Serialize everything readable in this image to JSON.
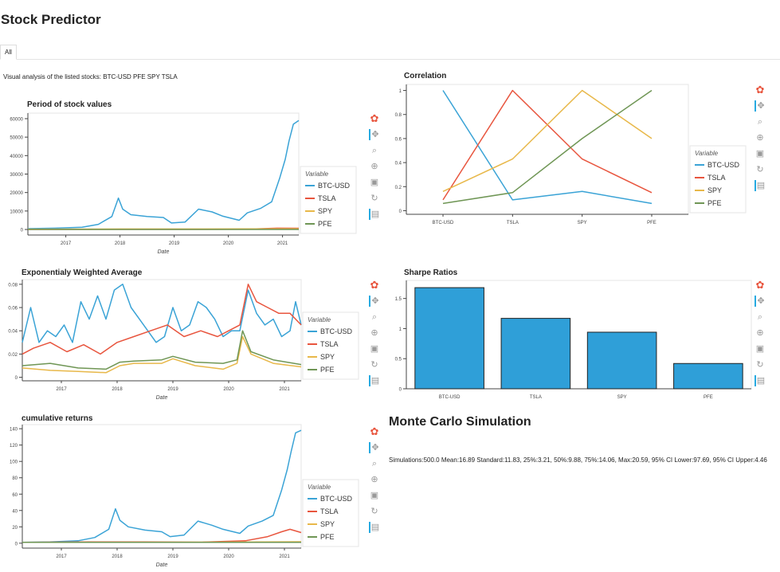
{
  "app": {
    "title": "Stock Predictor"
  },
  "tabs": [
    {
      "label": "All"
    }
  ],
  "intro": {
    "text": "Visual analysis of the listed stocks: BTC-USD PFE SPY TSLA"
  },
  "colors": {
    "BTC-USD": "#3aa3d6",
    "TSLA": "#e8553e",
    "SPY": "#e8b84a",
    "PFE": "#6f9655",
    "bar": "#2f9fd8"
  },
  "legend": {
    "title": "Variable",
    "items": [
      "BTC-USD",
      "TSLA",
      "SPY",
      "PFE"
    ]
  },
  "toolbar": {
    "icons": [
      "bokeh-logo-icon",
      "pan-icon",
      "box-zoom-icon",
      "wheel-zoom-icon",
      "save-icon",
      "reset-icon",
      "hover-icon"
    ]
  },
  "monte_carlo": {
    "title": "Monte Carlo Simulation",
    "text": "Simulations:500.0 Mean:16.89 Standard:11.83, 25%:3.21, 50%:9.88, 75%:14.06, Max:20.59, 95% CI Lower:97.69, 95% CI Upper:4.46"
  },
  "chart_data": [
    {
      "id": "stock-values",
      "type": "line",
      "title": "Period of stock values",
      "xlabel": "Date",
      "ylabel": "",
      "xticks": [
        "2017",
        "2018",
        "2019",
        "2020",
        "2021"
      ],
      "xlim": [
        2016.3,
        2021.3
      ],
      "ylim": [
        -3000,
        63000
      ],
      "yticks": [
        0,
        10000,
        20000,
        30000,
        40000,
        50000,
        60000
      ],
      "legend_position": "right",
      "series": [
        {
          "name": "BTC-USD",
          "x": [
            2016.3,
            2016.8,
            2017.3,
            2017.6,
            2017.85,
            2017.97,
            2018.05,
            2018.2,
            2018.5,
            2018.8,
            2018.95,
            2019.2,
            2019.45,
            2019.7,
            2019.9,
            2020.2,
            2020.35,
            2020.6,
            2020.8,
            2020.95,
            2021.05,
            2021.12,
            2021.2,
            2021.3
          ],
          "y": [
            450,
            700,
            1200,
            2800,
            7000,
            17000,
            11000,
            8000,
            7000,
            6500,
            3500,
            4000,
            11000,
            9500,
            7200,
            5000,
            9000,
            11500,
            15000,
            28000,
            38000,
            48000,
            57000,
            59000
          ]
        },
        {
          "name": "TSLA",
          "x": [
            2016.3,
            2017.5,
            2018.5,
            2019.5,
            2020.3,
            2020.9,
            2021.3
          ],
          "y": [
            40,
            60,
            70,
            50,
            150,
            700,
            650
          ]
        },
        {
          "name": "SPY",
          "x": [
            2016.3,
            2018,
            2019.5,
            2020.3,
            2021.3
          ],
          "y": [
            210,
            260,
            290,
            300,
            390
          ]
        },
        {
          "name": "PFE",
          "x": [
            2016.3,
            2021.3
          ],
          "y": [
            33,
            37
          ]
        }
      ]
    },
    {
      "id": "correlation",
      "type": "line",
      "title": "Correlation",
      "xlabel": "",
      "ylabel": "",
      "categories": [
        "BTC-USD",
        "TSLA",
        "SPY",
        "PFE"
      ],
      "ylim": [
        -0.03,
        1.05
      ],
      "yticks": [
        0,
        0.2,
        0.4,
        0.6,
        0.8,
        1
      ],
      "legend_position": "right",
      "series": [
        {
          "name": "BTC-USD",
          "values": [
            1.0,
            0.09,
            0.16,
            0.06
          ]
        },
        {
          "name": "TSLA",
          "values": [
            0.09,
            1.0,
            0.43,
            0.15
          ]
        },
        {
          "name": "SPY",
          "values": [
            0.16,
            0.43,
            1.0,
            0.6
          ]
        },
        {
          "name": "PFE",
          "values": [
            0.06,
            0.15,
            0.6,
            1.0
          ]
        }
      ]
    },
    {
      "id": "ewa",
      "type": "line",
      "title": "Exponentialy Weighted Average",
      "xlabel": "Date",
      "ylabel": "",
      "xticks": [
        "2017",
        "2018",
        "2019",
        "2020",
        "2021"
      ],
      "xlim": [
        2016.3,
        2021.3
      ],
      "ylim": [
        -0.003,
        0.084
      ],
      "yticks": [
        0,
        0.02,
        0.04,
        0.06,
        0.08
      ],
      "legend_position": "right",
      "series": [
        {
          "name": "BTC-USD",
          "x": [
            2016.3,
            2016.45,
            2016.6,
            2016.75,
            2016.9,
            2017.05,
            2017.2,
            2017.35,
            2017.5,
            2017.65,
            2017.8,
            2017.95,
            2018.1,
            2018.25,
            2018.4,
            2018.55,
            2018.7,
            2018.85,
            2019.0,
            2019.15,
            2019.3,
            2019.45,
            2019.6,
            2019.75,
            2019.9,
            2020.05,
            2020.2,
            2020.35,
            2020.5,
            2020.65,
            2020.8,
            2020.95,
            2021.1,
            2021.2,
            2021.3
          ],
          "y": [
            0.03,
            0.06,
            0.03,
            0.04,
            0.035,
            0.045,
            0.03,
            0.065,
            0.05,
            0.07,
            0.05,
            0.075,
            0.08,
            0.06,
            0.05,
            0.04,
            0.03,
            0.035,
            0.06,
            0.04,
            0.045,
            0.065,
            0.06,
            0.05,
            0.035,
            0.04,
            0.04,
            0.075,
            0.055,
            0.045,
            0.05,
            0.035,
            0.04,
            0.065,
            0.045
          ]
        },
        {
          "name": "TSLA",
          "x": [
            2016.3,
            2016.5,
            2016.8,
            2017.1,
            2017.4,
            2017.7,
            2018.0,
            2018.3,
            2018.6,
            2018.9,
            2019.2,
            2019.5,
            2019.8,
            2020.0,
            2020.2,
            2020.35,
            2020.5,
            2020.7,
            2020.9,
            2021.1,
            2021.3
          ],
          "y": [
            0.02,
            0.025,
            0.03,
            0.022,
            0.028,
            0.02,
            0.03,
            0.035,
            0.04,
            0.045,
            0.035,
            0.04,
            0.035,
            0.04,
            0.045,
            0.08,
            0.065,
            0.06,
            0.055,
            0.055,
            0.045
          ]
        },
        {
          "name": "SPY",
          "x": [
            2016.3,
            2016.8,
            2017.3,
            2017.8,
            2018.05,
            2018.3,
            2018.8,
            2019.0,
            2019.4,
            2019.9,
            2020.15,
            2020.25,
            2020.4,
            2020.8,
            2021.3
          ],
          "y": [
            0.008,
            0.006,
            0.005,
            0.004,
            0.01,
            0.012,
            0.012,
            0.016,
            0.01,
            0.007,
            0.012,
            0.035,
            0.02,
            0.012,
            0.009
          ]
        },
        {
          "name": "PFE",
          "x": [
            2016.3,
            2016.8,
            2017.3,
            2017.8,
            2018.05,
            2018.3,
            2018.8,
            2019.0,
            2019.4,
            2019.9,
            2020.15,
            2020.25,
            2020.4,
            2020.8,
            2021.3
          ],
          "y": [
            0.01,
            0.012,
            0.008,
            0.007,
            0.013,
            0.014,
            0.015,
            0.018,
            0.013,
            0.012,
            0.015,
            0.04,
            0.022,
            0.015,
            0.011
          ]
        }
      ]
    },
    {
      "id": "sharpe",
      "type": "bar",
      "title": "Sharpe Ratios",
      "xlabel": "",
      "ylabel": "",
      "categories": [
        "BTC-USD",
        "TSLA",
        "SPY",
        "PFE"
      ],
      "values": [
        1.68,
        1.17,
        0.94,
        0.42
      ],
      "ylim": [
        0,
        1.8
      ],
      "yticks": [
        0,
        0.5,
        1,
        1.5
      ]
    },
    {
      "id": "cumulative",
      "type": "line",
      "title": "cumulative returns",
      "xlabel": "Date",
      "ylabel": "",
      "xticks": [
        "2017",
        "2018",
        "2019",
        "2020",
        "2021"
      ],
      "xlim": [
        2016.3,
        2021.3
      ],
      "ylim": [
        -6,
        145
      ],
      "yticks": [
        0,
        20,
        40,
        60,
        80,
        100,
        120,
        140
      ],
      "legend_position": "right",
      "series": [
        {
          "name": "BTC-USD",
          "x": [
            2016.3,
            2016.8,
            2017.3,
            2017.6,
            2017.85,
            2017.97,
            2018.05,
            2018.2,
            2018.5,
            2018.8,
            2018.95,
            2019.2,
            2019.45,
            2019.7,
            2019.9,
            2020.2,
            2020.35,
            2020.6,
            2020.8,
            2020.95,
            2021.05,
            2021.12,
            2021.2,
            2021.3
          ],
          "y": [
            1,
            1.6,
            3,
            7,
            17,
            42,
            28,
            20,
            16,
            14,
            8,
            10,
            27,
            22,
            17,
            12,
            21,
            27,
            34,
            65,
            90,
            112,
            135,
            138
          ]
        },
        {
          "name": "TSLA",
          "x": [
            2016.3,
            2017.5,
            2018.5,
            2019.5,
            2020.3,
            2020.7,
            2020.95,
            2021.1,
            2021.3
          ],
          "y": [
            1,
            1.5,
            1.5,
            1.2,
            3,
            8,
            14,
            17,
            13
          ]
        },
        {
          "name": "SPY",
          "x": [
            2016.3,
            2018,
            2019.5,
            2020.3,
            2021.3
          ],
          "y": [
            1,
            1.2,
            1.35,
            1.4,
            1.8
          ]
        },
        {
          "name": "PFE",
          "x": [
            2016.3,
            2021.3
          ],
          "y": [
            1,
            1.1
          ]
        }
      ]
    }
  ]
}
